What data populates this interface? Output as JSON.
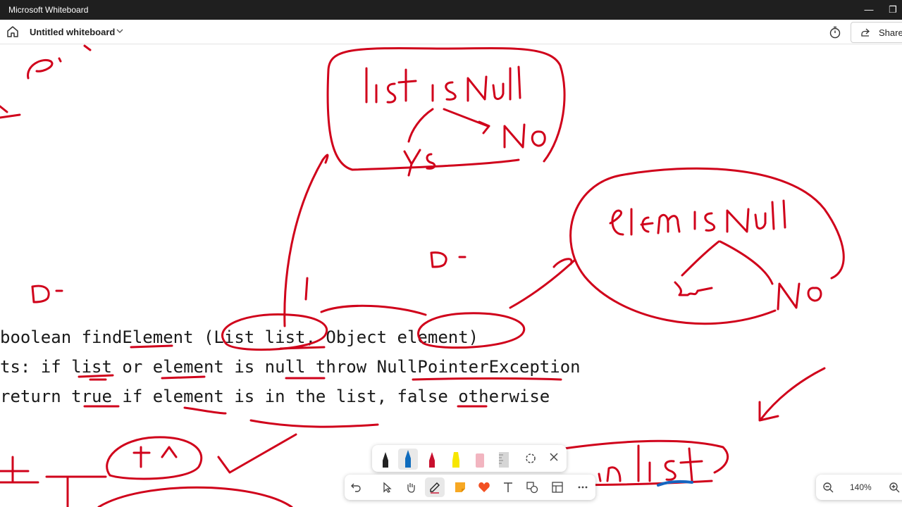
{
  "window": {
    "app_title": "Microsoft Whiteboard"
  },
  "toolbar": {
    "doc_title": "Untitled whiteboard",
    "share_label": "Share"
  },
  "code": {
    "line1": "boolean findElement (List list, Object element)",
    "line2": "ts: if list or element is null throw NullPointerException",
    "line3": "return true if element is in the list, false otherwise"
  },
  "zoom": {
    "level": "140%"
  },
  "colors": {
    "ink": "#d0021b",
    "ink_blue": "#1565c0",
    "titlebar": "#1f1f1f",
    "accent_pen": "#0f6cbd"
  },
  "tools": [
    "undo-icon",
    "select-icon",
    "hand-icon",
    "pen-icon",
    "sticky-note-icon",
    "reaction-icon",
    "text-icon",
    "shapes-icon",
    "template-icon",
    "more-icon"
  ],
  "pens": [
    "black-pen",
    "blue-pen",
    "red-pen",
    "yellow-highlighter",
    "eraser",
    "ruler",
    "lasso"
  ]
}
